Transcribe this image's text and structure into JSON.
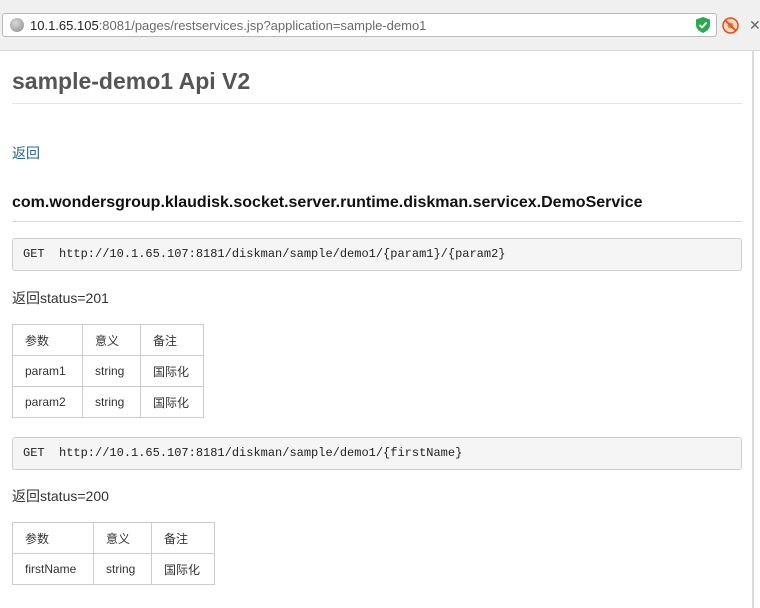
{
  "browser": {
    "url_host": "10.1.65.105",
    "url_rest": ":8081/pages/restservices.jsp?application=sample-demo1"
  },
  "page": {
    "title": "sample-demo1 Api V2",
    "back_link": "返回",
    "service_name": "com.wondersgroup.klaudisk.socket.server.runtime.diskman.servicex.DemoService"
  },
  "endpoints": [
    {
      "request": "GET  http://10.1.65.107:8181/diskman/sample/demo1/{param1}/{param2}",
      "status": "返回status=201",
      "headers": [
        "参数",
        "意义",
        "备注"
      ],
      "rows": [
        [
          "param1",
          "string",
          "国际化"
        ],
        [
          "param2",
          "string",
          "国际化"
        ]
      ]
    },
    {
      "request": "GET  http://10.1.65.107:8181/diskman/sample/demo1/{firstName}",
      "status": "返回status=200",
      "headers": [
        "参数",
        "意义",
        "备注"
      ],
      "rows": [
        [
          "firstName",
          "string",
          "国际化"
        ]
      ]
    }
  ]
}
